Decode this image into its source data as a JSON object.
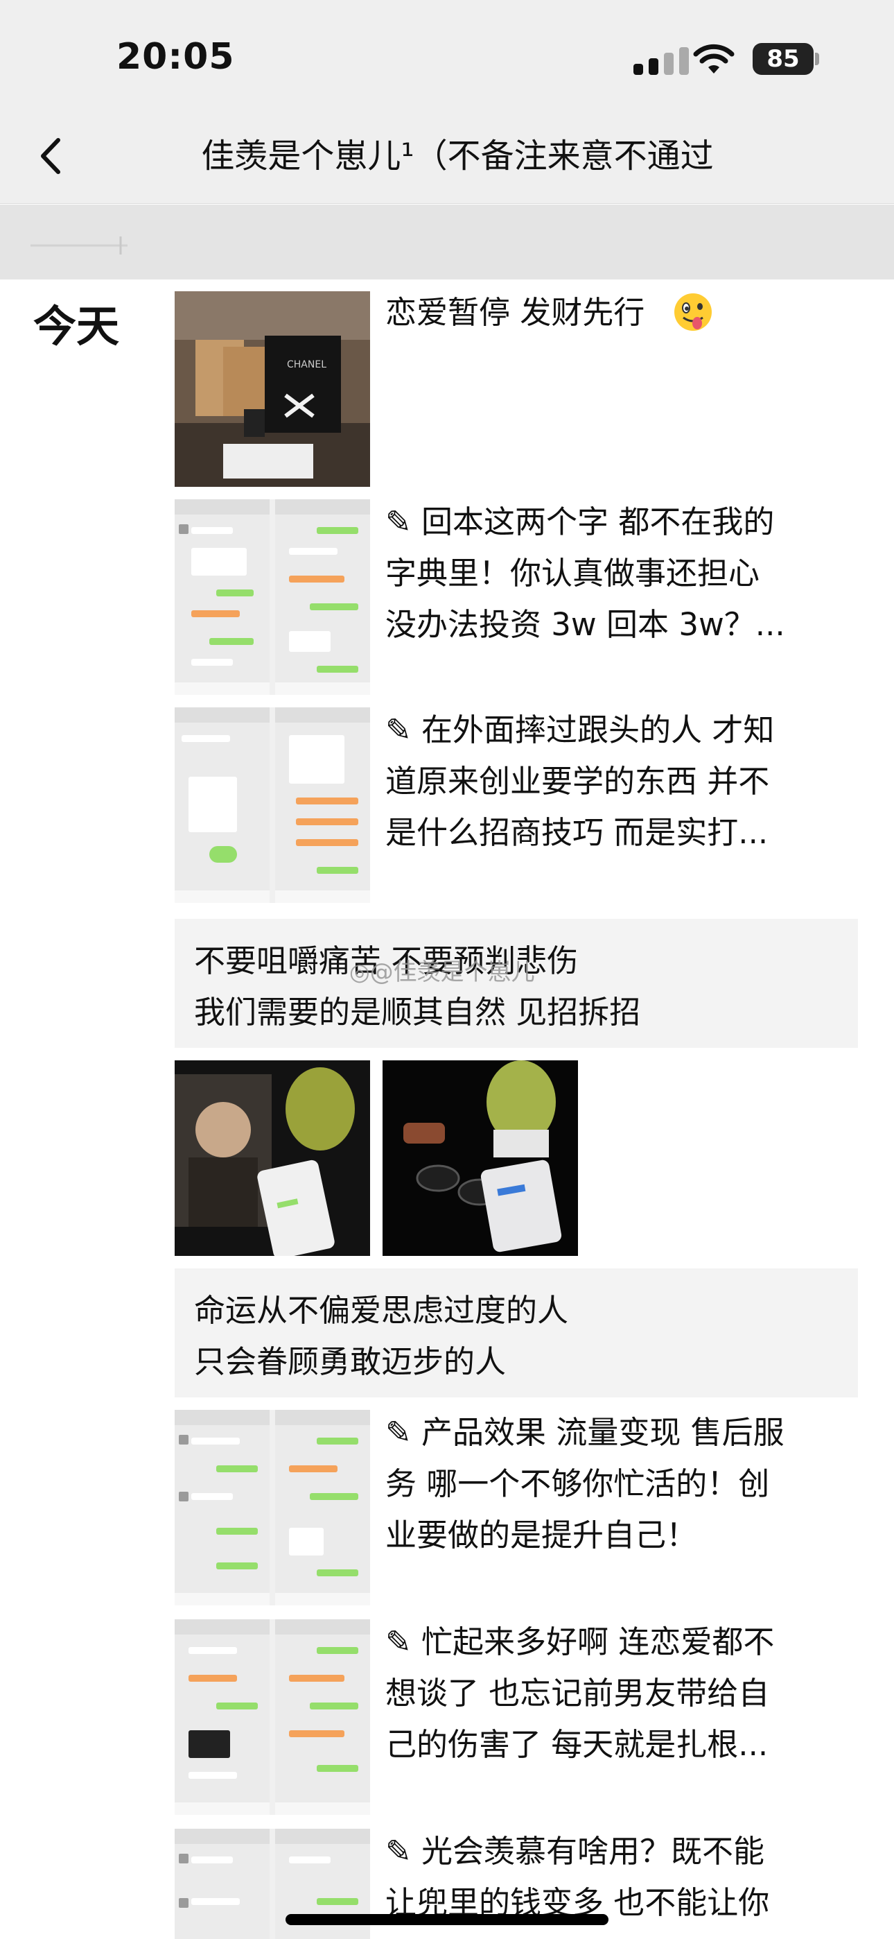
{
  "status_bar": {
    "time": "20:05",
    "battery": "85"
  },
  "nav": {
    "title": "佳羡是个崽儿¹（不备注来意不通过"
  },
  "feed": {
    "date_label": "今天",
    "posts": [
      {
        "text_lines": [
          "恋爱暂停 发财先行"
        ]
      },
      {
        "text_lines": [
          "✎ 回本这两个字 都不在我的",
          "字典里！你认真做事还担心",
          "没办法投资 3w 回本 3w？..."
        ]
      },
      {
        "text_lines": [
          "✎ 在外面摔过跟头的人 才知",
          "道原来创业要学的东西 并不",
          "是什么招商技巧 而是实打..."
        ]
      },
      {
        "text_lines": [
          "不要咀嚼痛苦 不要预判悲伤",
          "我们需要的是顺其自然 见招拆招"
        ]
      },
      {
        "text_lines": [
          "命运从不偏爱思虑过度的人",
          "只会眷顾勇敢迈步的人"
        ]
      },
      {
        "text_lines": [
          "✎ 产品效果 流量变现 售后服",
          "务 哪一个不够你忙活的！创",
          "业要做的是提升自己！"
        ]
      },
      {
        "text_lines": [
          "✎ 忙起来多好啊 连恋爱都不",
          "想谈了 也忘记前男友带给自",
          "己的伤害了 每天就是扎根..."
        ]
      },
      {
        "text_lines": [
          "✎ 光会羡慕有啥用？既不能",
          "让兜里的钱变多 也不能让你"
        ]
      }
    ]
  },
  "watermark": "◎@佳羡是个崽儿",
  "colors": {
    "chat_green": "#95de6b",
    "chat_orange": "#f5a25a",
    "header_bg": "#efefef",
    "card_bg": "#f3f3f3"
  },
  "icons": [
    "back-chevron-icon",
    "cellular-signal-icon",
    "wifi-icon",
    "battery-icon",
    "pencil-icon",
    "tongue-emoji-icon"
  ]
}
